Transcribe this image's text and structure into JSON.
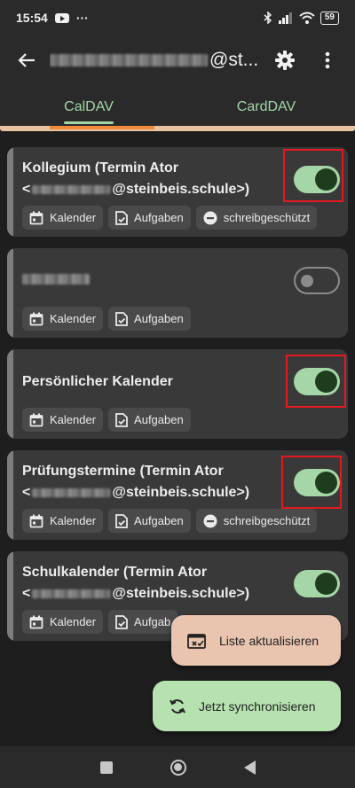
{
  "status_bar": {
    "time": "15:54",
    "overflow_indicator": "···",
    "battery": "59"
  },
  "app_bar": {
    "account_suffix": "@st..."
  },
  "tabs": [
    {
      "label": "CalDAV",
      "active": true
    },
    {
      "label": "CardDAV",
      "active": false
    }
  ],
  "collections": [
    {
      "title_line1": "Kollegium (Termin Ator",
      "title_line2_prefix": "<",
      "title_line2_suffix": "@steinbeis.schule>)",
      "sync_enabled": true,
      "chips": [
        "Kalender",
        "Aufgaben",
        "schreibgeschützt"
      ]
    },
    {
      "title_line1": "",
      "sync_enabled": false,
      "chips": [
        "Kalender",
        "Aufgaben"
      ]
    },
    {
      "title_line1": "Persönlicher Kalender",
      "sync_enabled": true,
      "chips": [
        "Kalender",
        "Aufgaben"
      ]
    },
    {
      "title_line1": "Prüfungstermine (Termin Ator",
      "title_line2_prefix": "<",
      "title_line2_suffix": "@steinbeis.schule>)",
      "sync_enabled": true,
      "chips": [
        "Kalender",
        "Aufgaben",
        "schreibgeschützt"
      ]
    },
    {
      "title_line1": "Schulkalender (Termin Ator",
      "title_line2_prefix": "<",
      "title_line2_suffix": "@steinbeis.schule>)",
      "sync_enabled": true,
      "chips": [
        "Kalender",
        "Aufgab"
      ]
    }
  ],
  "fabs": {
    "refresh_label": "Liste aktualisieren",
    "sync_label": "Jetzt synchronisieren"
  },
  "colors": {
    "accent_green": "#a5d6a7",
    "highlight_red": "#e5171f",
    "tab_indicator_orange": "#ef8a3a"
  }
}
